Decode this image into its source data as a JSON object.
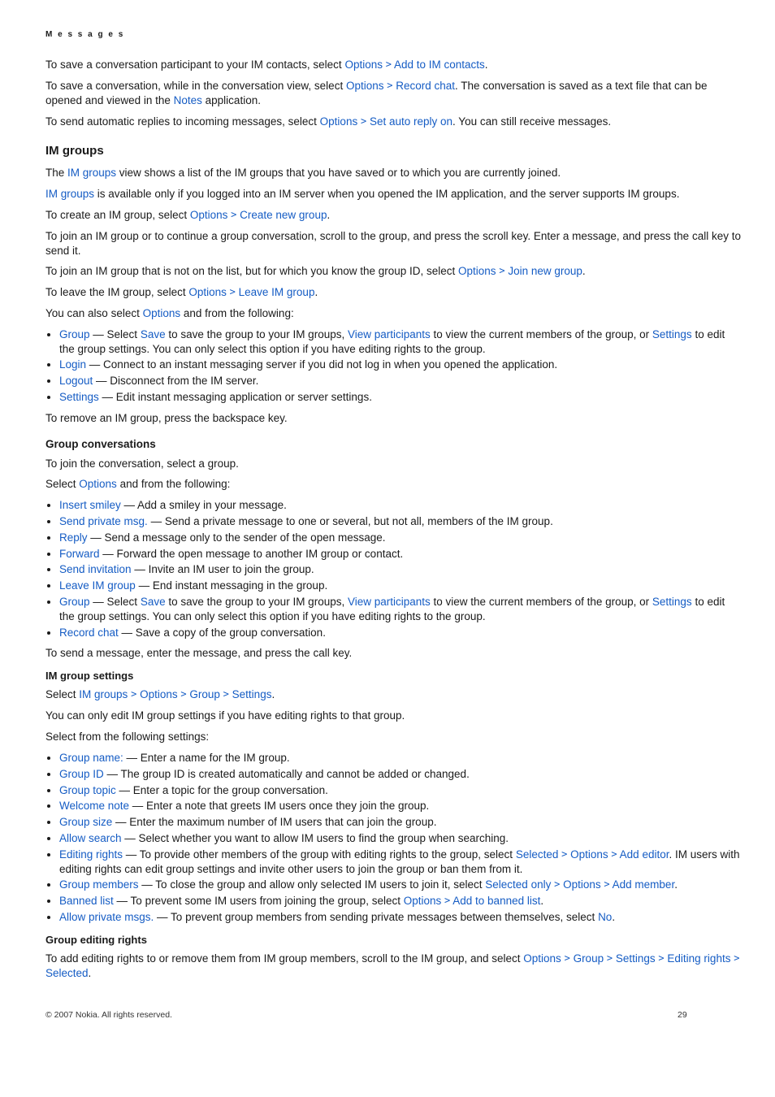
{
  "header": {
    "section": "M e s s a g e s"
  },
  "intro": {
    "p1_a": "To save a conversation participant to your IM contacts, select ",
    "p1_opt": "Options",
    "p1_b": "Add to IM contacts",
    "p1_c": ".",
    "p2_a": "To save a conversation, while in the conversation view, select ",
    "p2_opt": "Options",
    "p2_b": "Record chat",
    "p2_c": ". The conversation is saved as a text file that can be opened and viewed in the ",
    "p2_notes": "Notes",
    "p2_d": " application.",
    "p3_a": "To send automatic replies to incoming messages, select ",
    "p3_opt": "Options",
    "p3_b": "Set auto reply on",
    "p3_c": ". You can still receive messages."
  },
  "im_groups_heading": "IM groups",
  "g": {
    "p1_a": "The ",
    "p1_b": "IM groups",
    "p1_c": " view shows a list of the IM groups that you have saved or to which you are currently joined.",
    "p2_a": "IM groups",
    "p2_b": " is available only if you logged into an IM server when you opened the IM application, and the server supports IM groups.",
    "p3_a": "To create an IM group, select ",
    "p3_opt": "Options",
    "p3_b": "Create new group",
    "p3_c": ".",
    "p4": "To join an IM group or to continue a group conversation, scroll to the group, and press the scroll key. Enter a message, and press the call key to send it.",
    "p5_a": "To join an IM group that is not on the list, but for which you know the group ID, select ",
    "p5_opt": "Options",
    "p5_b": "Join new group",
    "p5_c": ".",
    "p6_a": "To leave the IM group, select ",
    "p6_opt": "Options",
    "p6_b": "Leave IM group",
    "p6_c": ".",
    "p7_a": "You can also select ",
    "p7_opt": "Options",
    "p7_b": " and from the following:"
  },
  "g_list": [
    {
      "k": "Group",
      "pre": " — Select ",
      "k2": "Save",
      "mid": " to save the group to your IM groups, ",
      "k3": "View participants",
      "mid2": " to view the current members of the group, or ",
      "k4": "Settings",
      "tail": " to edit the group settings. You can only select this option if you have editing rights to the group."
    },
    {
      "k": "Login",
      "tail": " — Connect to an instant messaging server if you did not log in when you opened the application."
    },
    {
      "k": "Logout",
      "tail": " — Disconnect from the IM server."
    },
    {
      "k": "Settings",
      "tail": " — Edit instant messaging application or server settings."
    }
  ],
  "g_after": "To remove an IM group, press the backspace key.",
  "conv_heading": "Group conversations",
  "conv": {
    "p1": "To join the conversation, select a group.",
    "p2_a": "Select ",
    "p2_opt": "Options",
    "p2_b": " and from the following:"
  },
  "conv_list": [
    {
      "k": "Insert smiley",
      "tail": " — Add a smiley in your message."
    },
    {
      "k": "Send private msg.",
      "tail": " — Send a private message to one or several, but not all, members of the IM group."
    },
    {
      "k": "Reply",
      "tail": " — Send a message only to the sender of the open message."
    },
    {
      "k": "Forward",
      "tail": " — Forward the open message to another IM group or contact."
    },
    {
      "k": "Send invitation",
      "tail": " — Invite an IM user to join the group."
    },
    {
      "k": "Leave IM group",
      "tail": " — End instant messaging in the group."
    },
    {
      "k": "Group",
      "pre": " — Select ",
      "k2": "Save",
      "mid": " to save the group to your IM groups, ",
      "k3": "View participants",
      "mid2": " to view the current members of the group, or ",
      "k4": "Settings",
      "tail": " to edit the group settings. You can only select this option if you have editing rights to the group."
    },
    {
      "k": "Record chat",
      "tail": " — Save a copy of the group conversation."
    }
  ],
  "conv_after": "To send a message, enter the message, and press the call key.",
  "settings_heading": "IM group settings",
  "settings": {
    "p1_a": "Select ",
    "p1_b": "IM groups",
    "p1_c": "Options",
    "p1_d": "Group",
    "p1_e": "Settings",
    "p1_f": ".",
    "p2": "You can only edit IM group settings if you have editing rights to that group.",
    "p3": "Select from the following settings:"
  },
  "settings_list": [
    {
      "k": "Group name:",
      "tail": " — Enter a name for the IM group."
    },
    {
      "k": "Group ID",
      "tail": " — The group ID is created automatically and cannot be added or changed."
    },
    {
      "k": "Group topic",
      "tail": " — Enter a topic for the group conversation."
    },
    {
      "k": "Welcome note",
      "tail": " — Enter a note that greets IM users once they join the group."
    },
    {
      "k": "Group size",
      "tail": " — Enter the maximum number of IM users that can join the group."
    },
    {
      "k": "Allow search",
      "tail": " — Select whether you want to allow IM users to find the group when searching."
    },
    {
      "k": "Editing rights",
      "pre": " — To provide other members of the group with editing rights to the group, select ",
      "k2": "Selected",
      "k3": "Options",
      "k4": "Add editor",
      "tail": ". IM users with editing rights can edit group settings and invite other users to join the group or ban them from it."
    },
    {
      "k": "Group members",
      "pre": " — To close the group and allow only selected IM users to join it, select ",
      "k2": "Selected only",
      "k3": "Options",
      "k4": "Add member",
      "tail": "."
    },
    {
      "k": "Banned list",
      "pre": " — To prevent some IM users from joining the group, select ",
      "k2": "Options",
      "k3": "Add to banned list",
      "tail": "."
    },
    {
      "k": "Allow private msgs.",
      "pre": " — To prevent group members from sending private messages between themselves, select ",
      "k2": "No",
      "tail": "."
    }
  ],
  "rights_heading": "Group editing rights",
  "rights": {
    "p1_a": "To add editing rights to or remove them from IM group members, scroll to the IM group, and select ",
    "p1_b": "Options",
    "p1_c": "Group",
    "p1_d": "Settings",
    "p1_e": "Editing rights",
    "p1_f": "Selected",
    "p1_g": "."
  },
  "footer": {
    "copy": "© 2007 Nokia. All rights reserved.",
    "page": "29"
  },
  "chevron": ">"
}
